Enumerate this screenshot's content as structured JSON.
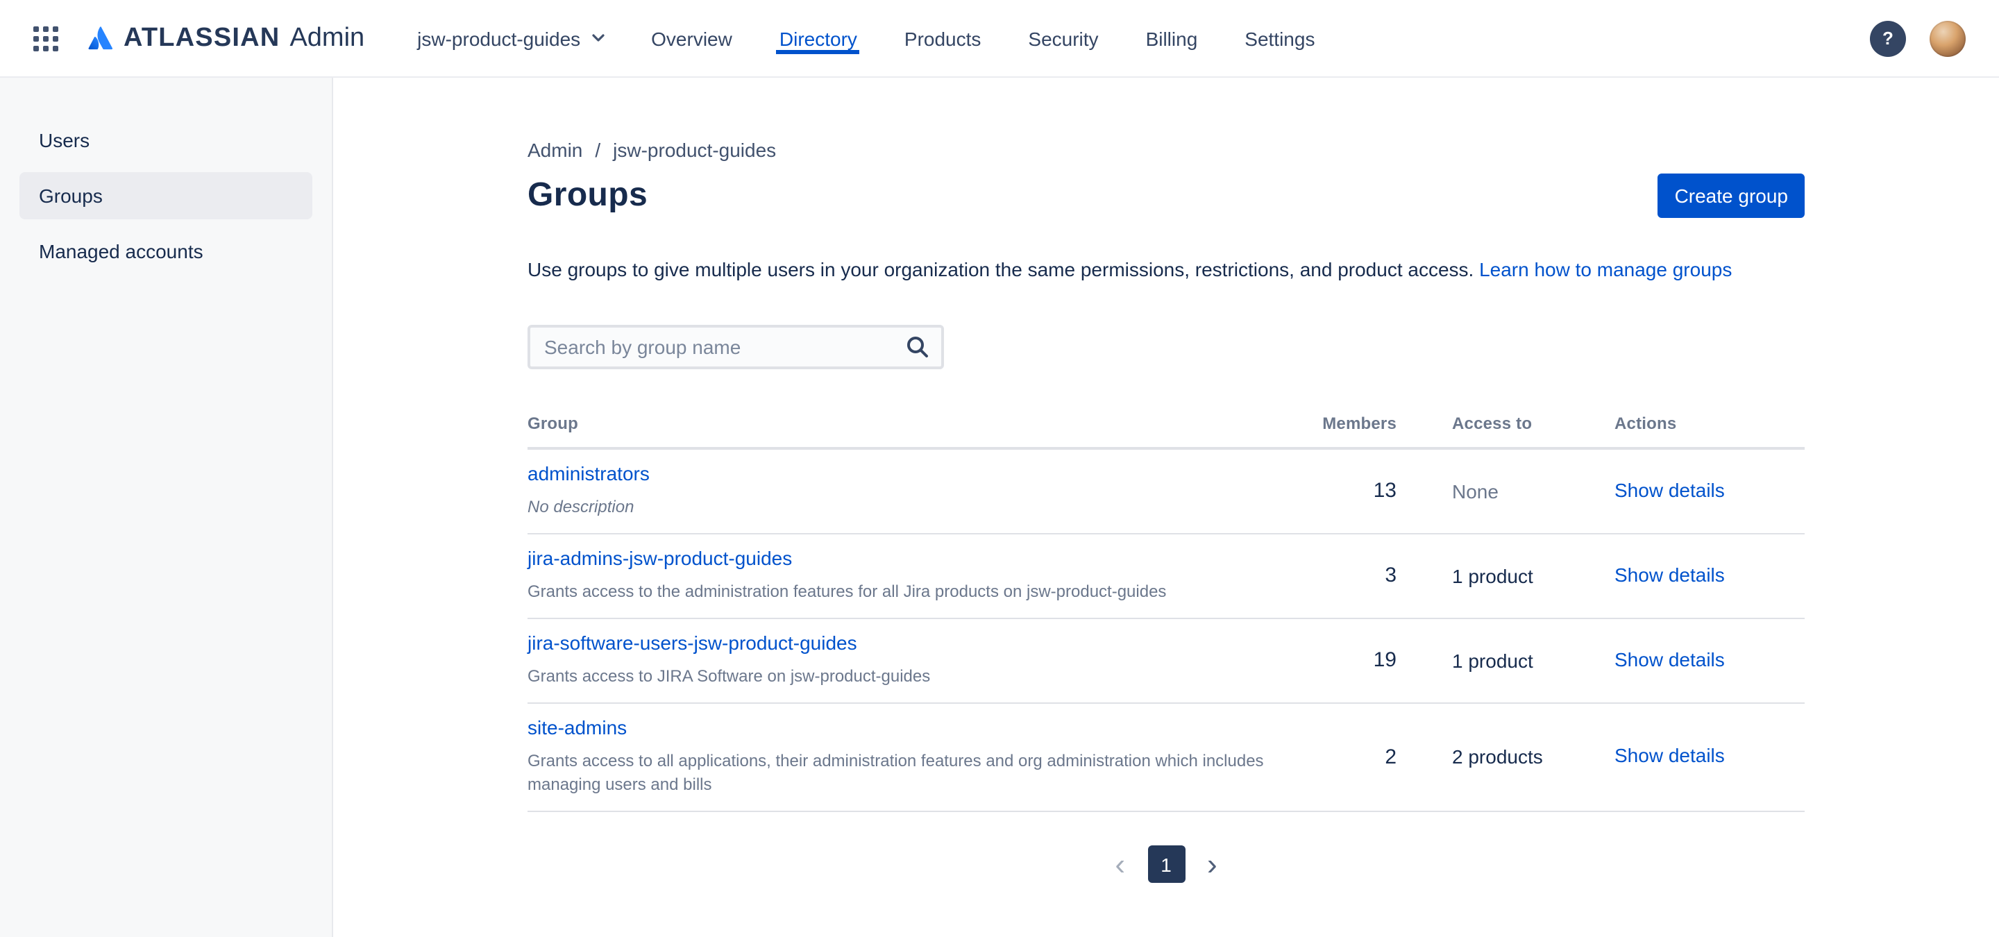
{
  "header": {
    "brand": {
      "wordmark": "ATLASSIAN",
      "product": "Admin"
    },
    "site_selector": {
      "label": "jsw-product-guides"
    },
    "nav": [
      {
        "label": "Overview"
      },
      {
        "label": "Directory"
      },
      {
        "label": "Products"
      },
      {
        "label": "Security"
      },
      {
        "label": "Billing"
      },
      {
        "label": "Settings"
      }
    ],
    "help_glyph": "?"
  },
  "sidebar": {
    "items": [
      {
        "label": "Users"
      },
      {
        "label": "Groups"
      },
      {
        "label": "Managed accounts"
      }
    ]
  },
  "main": {
    "breadcrumb": {
      "items": [
        "Admin",
        "jsw-product-guides"
      ],
      "separator": "/"
    },
    "title": "Groups",
    "create_button_label": "Create group",
    "intro_text": "Use groups to give multiple users in your organization the same permissions, restrictions, and product access.",
    "intro_link_label": "Learn how to manage groups",
    "search": {
      "placeholder": "Search by group name"
    },
    "table": {
      "headers": {
        "group": "Group",
        "members": "Members",
        "access": "Access to",
        "actions": "Actions"
      },
      "rows": [
        {
          "name": "administrators",
          "description": "No description",
          "members": "13",
          "access": "None",
          "action": "Show details"
        },
        {
          "name": "jira-admins-jsw-product-guides",
          "description": "Grants access to the administration features for all Jira products on jsw-product-guides",
          "members": "3",
          "access": "1 product",
          "action": "Show details"
        },
        {
          "name": "jira-software-users-jsw-product-guides",
          "description": "Grants access to JIRA Software on jsw-product-guides",
          "members": "19",
          "access": "1 product",
          "action": "Show details"
        },
        {
          "name": "site-admins",
          "description": "Grants access to all applications, their administration features and org administration which includes managing users and bills",
          "members": "2",
          "access": "2 products",
          "action": "Show details"
        }
      ]
    },
    "pagination": {
      "prev_glyph": "‹",
      "current_page": "1",
      "next_glyph": "›"
    }
  },
  "icons": {
    "app_switcher": "grid-of-dots",
    "atlassian_logo": "atlassian-mark",
    "site_chevron": "chevron-down",
    "search": "magnifier",
    "help": "question-mark-circle",
    "pagination_prev": "chevron-left",
    "pagination_next": "chevron-right"
  },
  "colors": {
    "accent_blue": "#0052CC",
    "link_blue": "#0052CC",
    "text_primary": "#172B4D",
    "text_muted": "#6B778C",
    "nav_active": "#0052CC",
    "sidebar_bg": "#F7F8F9",
    "sidebar_selected_bg": "#EBECF0",
    "button_primary_bg": "#0052CC",
    "pagination_current_bg": "#253858",
    "help_icon_bg": "#344563"
  }
}
